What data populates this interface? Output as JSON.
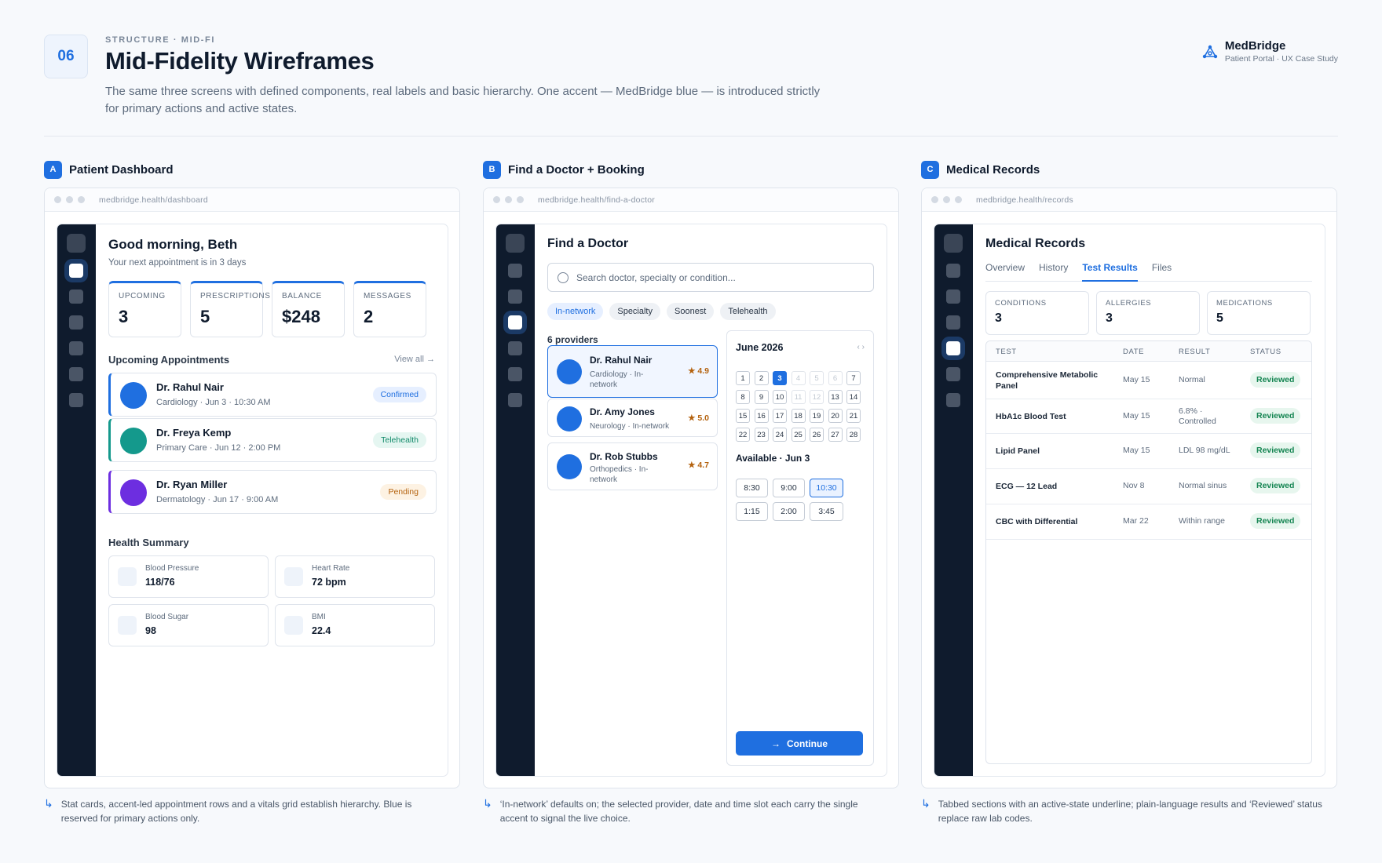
{
  "header": {
    "number": "06",
    "eyebrow": "STRUCTURE · MID-FI",
    "title": "Mid-Fidelity Wireframes",
    "description": "The same three screens with defined components, real labels and basic hierarchy. One accent — MedBridge blue — is introduced strictly for primary actions and active states.",
    "brand_name": "MedBridge",
    "brand_sub": "Patient Portal · UX Case Study",
    "brand_logo_icon": "network-logo-icon"
  },
  "colors": {
    "accent": "#1f6fe0",
    "sidebar": "#0f1b2d",
    "success": "#158552",
    "warning": "#b4620e",
    "teal": "#14998c",
    "purple": "#6d2ee0"
  },
  "dashboard": {
    "letter": "A",
    "label": "Patient Dashboard",
    "url": "medbridge.health/dashboard",
    "greeting": "Good morning, Beth",
    "greeting_sub": "Your next appointment is in 3 days",
    "stats": [
      {
        "label": "UPCOMING",
        "value": "3"
      },
      {
        "label": "PRESCRIPTIONS",
        "value": "5"
      },
      {
        "label": "BALANCE",
        "value": "$248"
      },
      {
        "label": "MESSAGES",
        "value": "2"
      }
    ],
    "appointments_title": "Upcoming Appointments",
    "view_all": "View all →",
    "appointments": [
      {
        "name": "Dr. Rahul Nair",
        "meta": "Cardiology · Jun 3 · 10:30 AM",
        "status": "Confirmed",
        "color": "#1f6fe0",
        "pill_bg": "#e6efff",
        "pill_fg": "#1f6fe0"
      },
      {
        "name": "Dr. Freya Kemp",
        "meta": "Primary Care · Jun 12 · 2:00 PM",
        "status": "Telehealth",
        "color": "#14998c",
        "pill_bg": "#e5f6f1",
        "pill_fg": "#128a6a"
      },
      {
        "name": "Dr. Ryan Miller",
        "meta": "Dermatology · Jun 17 · 9:00 AM",
        "status": "Pending",
        "color": "#6d2ee0",
        "pill_bg": "#fdf2e3",
        "pill_fg": "#b4620e"
      }
    ],
    "health_title": "Health Summary",
    "vitals": [
      {
        "label": "Blood Pressure",
        "value": "118/76"
      },
      {
        "label": "Heart Rate",
        "value": "72 bpm"
      },
      {
        "label": "Blood Sugar",
        "value": "98"
      },
      {
        "label": "BMI",
        "value": "22.4"
      }
    ],
    "note": "Stat cards, accent-led appointment rows and a vitals grid establish hierarchy. Blue is reserved for primary actions only."
  },
  "find_doctor": {
    "letter": "B",
    "label": "Find a Doctor + Booking",
    "url": "medbridge.health/find-a-doctor",
    "title": "Find a Doctor",
    "search_placeholder": "Search doctor, specialty or condition...",
    "chips": [
      {
        "label": "In-network",
        "active": true
      },
      {
        "label": "Specialty",
        "active": false
      },
      {
        "label": "Soonest",
        "active": false
      },
      {
        "label": "Telehealth",
        "active": false
      }
    ],
    "providers_count": "6 providers",
    "providers": [
      {
        "name": "Dr. Rahul Nair",
        "meta": "Cardiology · In-network",
        "rating": "★ 4.9",
        "selected": true
      },
      {
        "name": "Dr. Amy Jones",
        "meta": "Neurology · In-network",
        "rating": "★ 5.0",
        "selected": false
      },
      {
        "name": "Dr. Rob Stubbs",
        "meta": "Orthopedics · In-network",
        "rating": "★ 4.7",
        "selected": false
      }
    ],
    "month": "June 2026",
    "month_arrows": "‹ ›",
    "selected_day": 3,
    "disabled_days": [
      4,
      5,
      6,
      11,
      12
    ],
    "available_label": "Available · Jun 3",
    "slots": [
      {
        "label": "8:30",
        "selected": false
      },
      {
        "label": "9:00",
        "selected": false
      },
      {
        "label": "10:30",
        "selected": true
      },
      {
        "label": "1:15",
        "selected": false
      },
      {
        "label": "2:00",
        "selected": false
      },
      {
        "label": "3:45",
        "selected": false
      }
    ],
    "continue_label": "Continue",
    "note": "‘In-network’ defaults on; the selected provider, date and time slot each carry the single accent to signal the live choice."
  },
  "records": {
    "letter": "C",
    "label": "Medical Records",
    "url": "medbridge.health/records",
    "title": "Medical Records",
    "tabs": [
      {
        "label": "Overview",
        "active": false
      },
      {
        "label": "History",
        "active": false
      },
      {
        "label": "Test Results",
        "active": true
      },
      {
        "label": "Files",
        "active": false
      }
    ],
    "stats": [
      {
        "label": "CONDITIONS",
        "value": "3"
      },
      {
        "label": "ALLERGIES",
        "value": "3"
      },
      {
        "label": "MEDICATIONS",
        "value": "5"
      }
    ],
    "columns": {
      "test": "TEST",
      "date": "DATE",
      "result": "RESULT",
      "status": "STATUS"
    },
    "rows": [
      {
        "test": "Comprehensive Metabolic Panel",
        "date": "May 15",
        "result": "Normal",
        "status": "Reviewed"
      },
      {
        "test": "HbA1c Blood Test",
        "date": "May 15",
        "result": "6.8% · Controlled",
        "status": "Reviewed"
      },
      {
        "test": "Lipid Panel",
        "date": "May 15",
        "result": "LDL 98 mg/dL",
        "status": "Reviewed"
      },
      {
        "test": "ECG — 12 Lead",
        "date": "Nov 8",
        "result": "Normal sinus",
        "status": "Reviewed"
      },
      {
        "test": "CBC with Differential",
        "date": "Mar 22",
        "result": "Within range",
        "status": "Reviewed"
      }
    ],
    "note": "Tabbed sections with an active-state underline; plain-language results and ‘Reviewed’ status replace raw lab codes."
  }
}
